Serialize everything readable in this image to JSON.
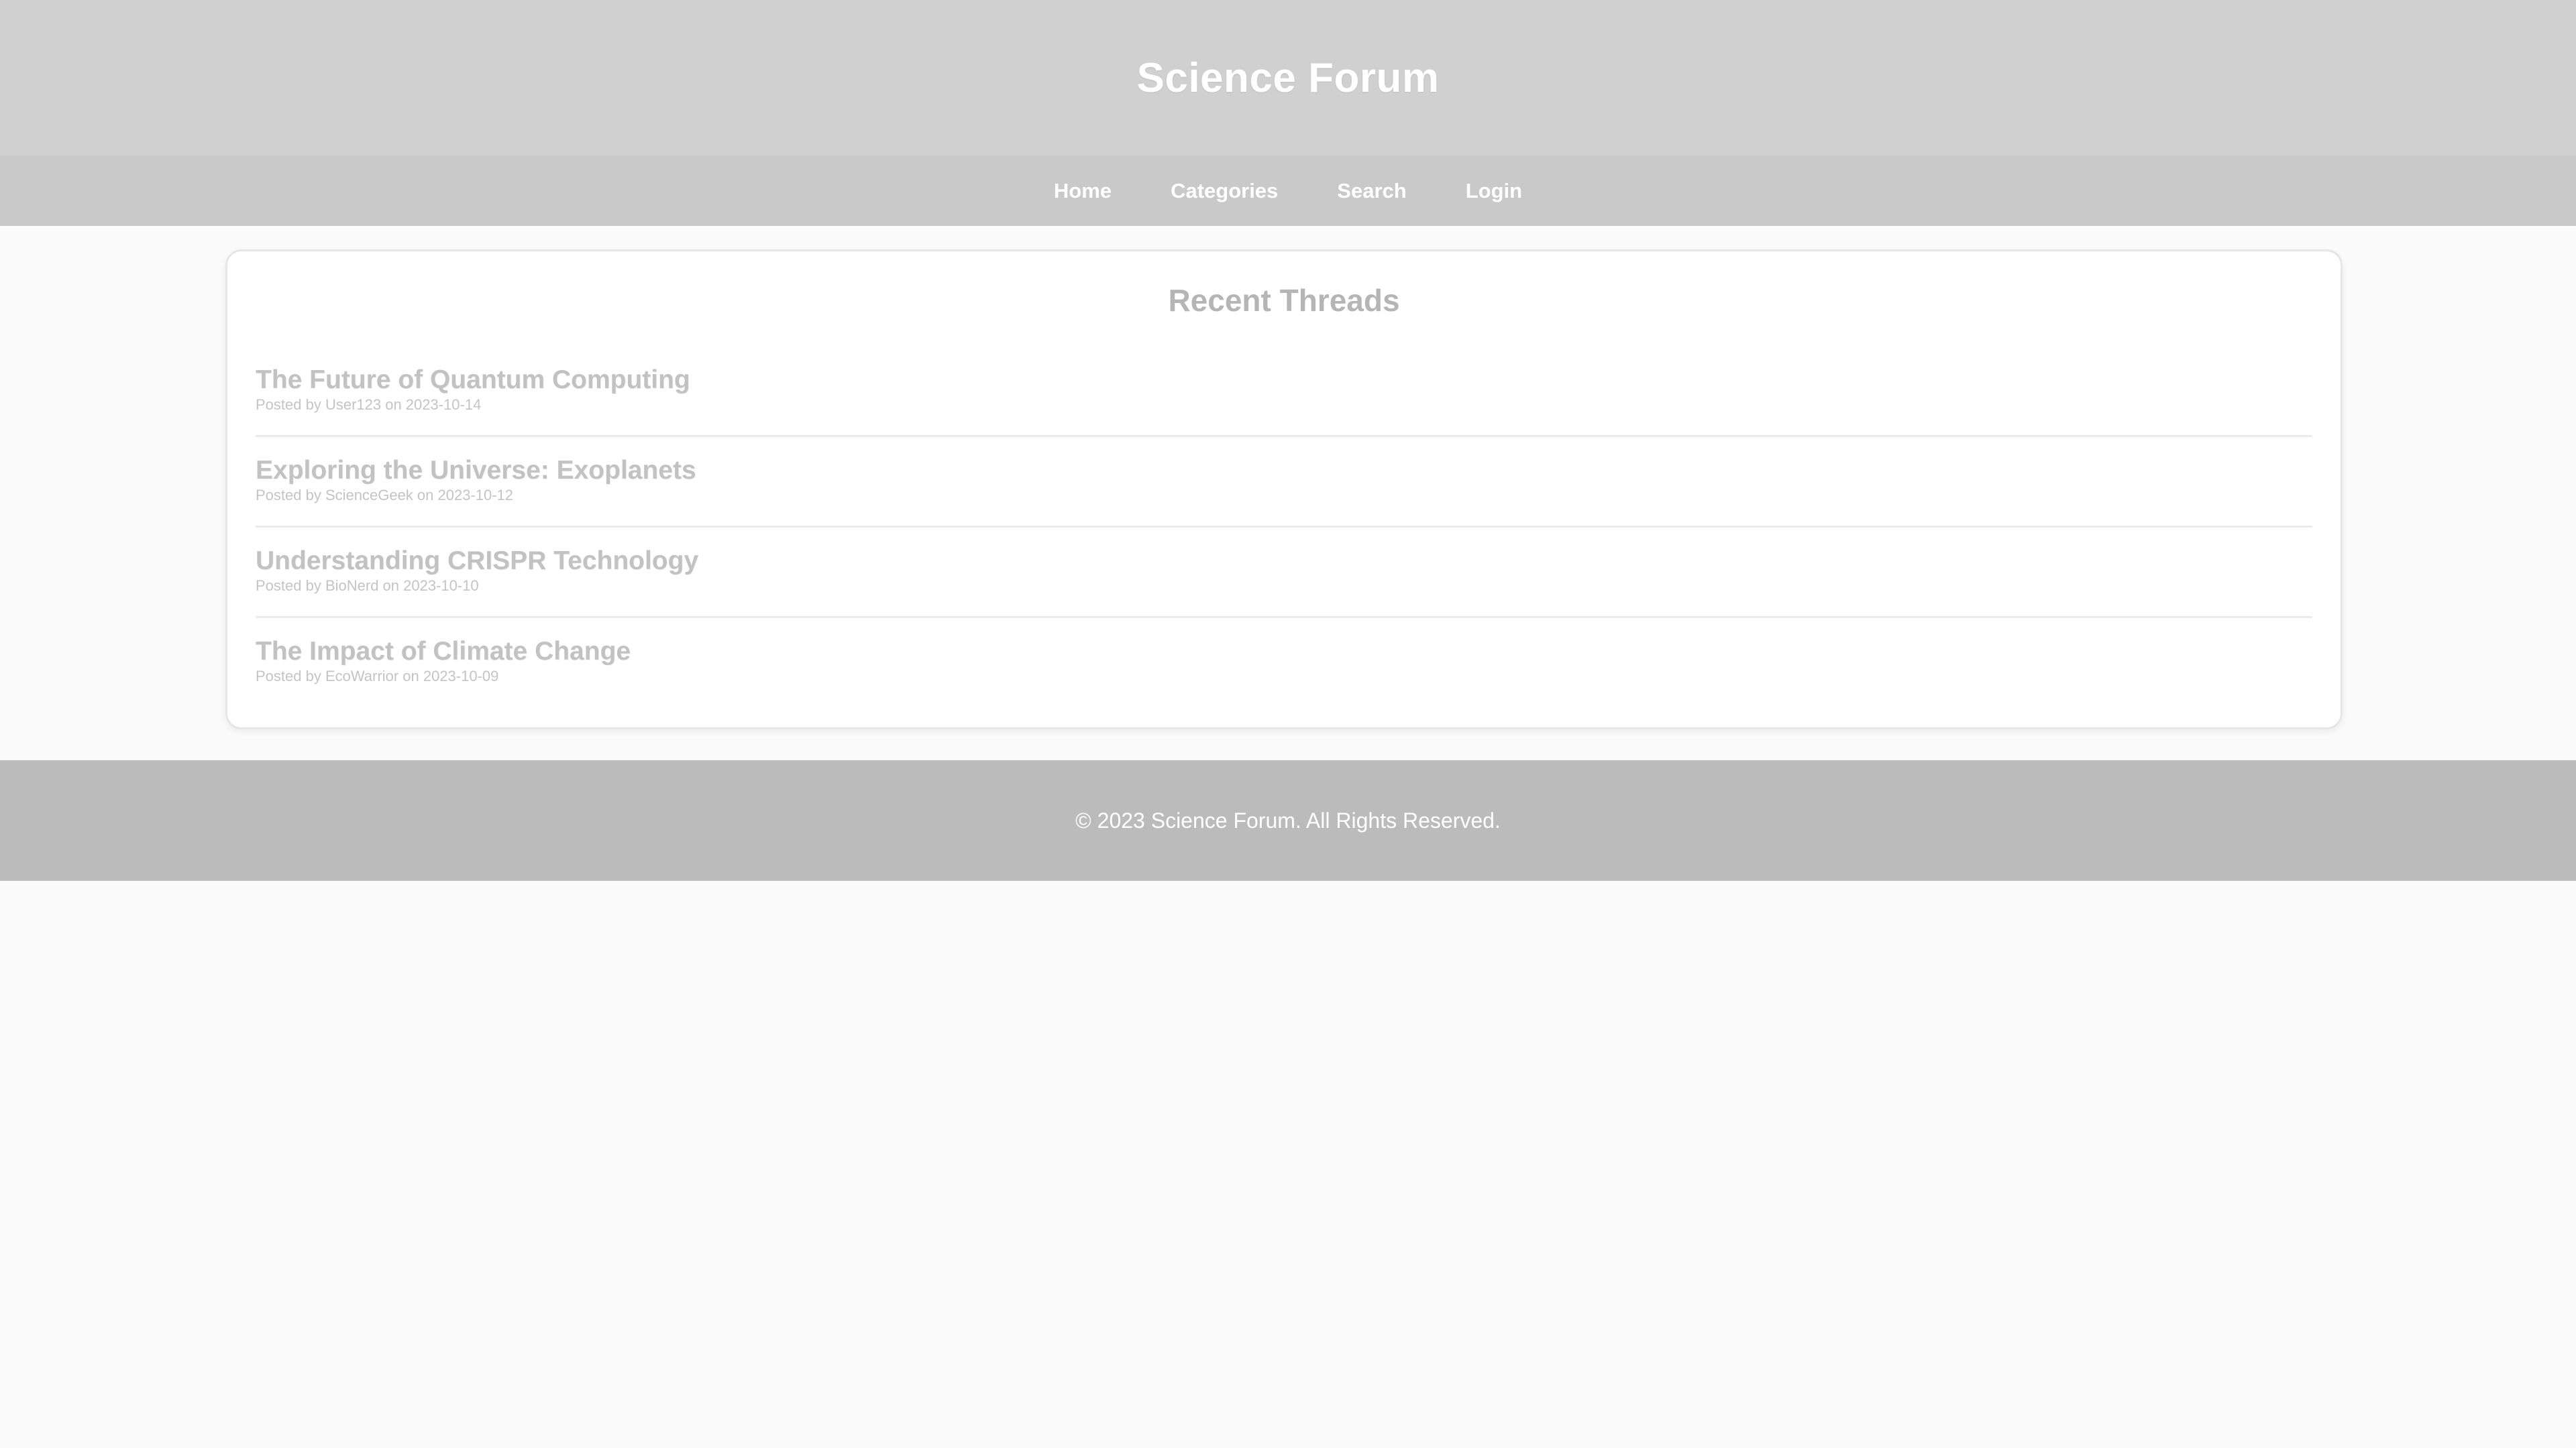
{
  "header": {
    "title": "Science Forum"
  },
  "nav": {
    "items": [
      {
        "label": "Home"
      },
      {
        "label": "Categories"
      },
      {
        "label": "Search"
      },
      {
        "label": "Login"
      }
    ]
  },
  "main": {
    "heading": "Recent Threads",
    "threads": [
      {
        "title": "The Future of Quantum Computing",
        "meta": "Posted by User123 on 2023-10-14"
      },
      {
        "title": "Exploring the Universe: Exoplanets",
        "meta": "Posted by ScienceGeek on 2023-10-12"
      },
      {
        "title": "Understanding CRISPR Technology",
        "meta": "Posted by BioNerd on 2023-10-10"
      },
      {
        "title": "The Impact of Climate Change",
        "meta": "Posted by EcoWarrior on 2023-10-09"
      }
    ]
  },
  "footer": {
    "text": "© 2023 Science Forum. All Rights Reserved."
  },
  "colors": {
    "header_bg": "#d0d0d0",
    "nav_bg": "#c9c9c9",
    "footer_bg": "#bbbbbb",
    "page_bg": "#fafafa"
  }
}
